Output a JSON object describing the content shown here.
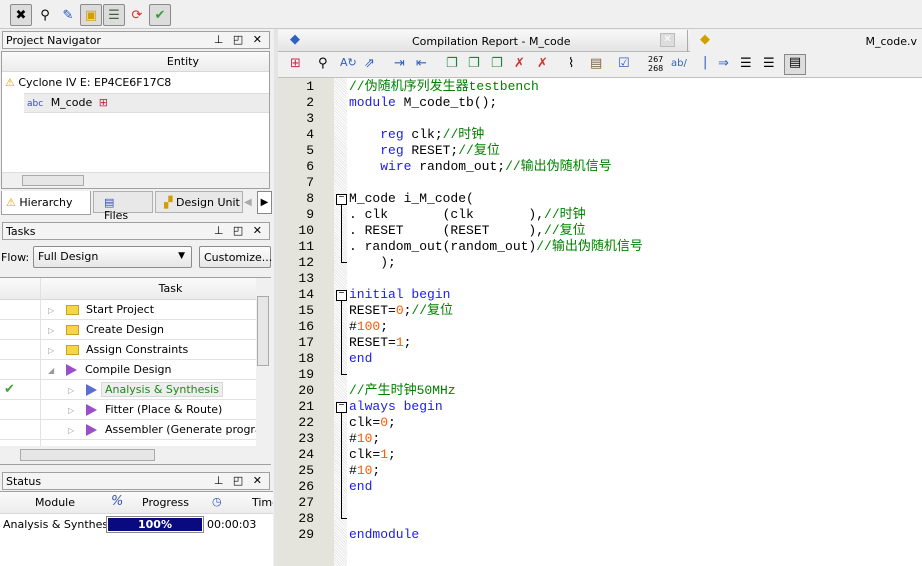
{
  "toolbar": {
    "icons": [
      "compile-stop-icon",
      "rtl-viewer-icon",
      "edit-icon",
      "pin-planner-icon",
      "chip-planner-icon",
      "refresh-icon",
      "checklist-icon"
    ]
  },
  "navigator": {
    "title": "Project Navigator",
    "col": "Entity",
    "device": "Cyclone IV E: EP4CE6F17C8",
    "entity": "M_code",
    "tabs": [
      {
        "label": "Hierarchy"
      },
      {
        "label": "Files"
      },
      {
        "label": "Design Unit"
      }
    ]
  },
  "tasks": {
    "title": "Tasks",
    "flow_label": "Flow:",
    "flow_value": "Full Design",
    "customize": "Customize...",
    "col": "Task",
    "rows": [
      {
        "label": "Start Project",
        "icon": "folder",
        "indent": 0,
        "status": ""
      },
      {
        "label": "Create Design",
        "icon": "folder",
        "indent": 0,
        "status": ""
      },
      {
        "label": "Assign Constraints",
        "icon": "folder",
        "indent": 0,
        "status": ""
      },
      {
        "label": "Compile Design",
        "icon": "play",
        "indent": 0,
        "status": "",
        "expanded": true
      },
      {
        "label": "Analysis & Synthesis",
        "icon": "play-blue",
        "indent": 1,
        "status": "done",
        "selected": true
      },
      {
        "label": "Fitter (Place & Route)",
        "icon": "play",
        "indent": 1,
        "status": ""
      },
      {
        "label": "Assembler (Generate programming files)",
        "icon": "play",
        "indent": 1,
        "status": ""
      }
    ]
  },
  "status": {
    "title": "Status",
    "cols": [
      "Module",
      "%",
      "Progress",
      "Time"
    ],
    "module": "Analysis & Synthesis",
    "progress_pct": 100,
    "progress_label": "100%",
    "time": "00:00:03"
  },
  "editor": {
    "tab_report": "Compilation Report - M_code",
    "tab_file": "M_code.v",
    "toolbar_lines": "267\n268",
    "toolbar_ab": "ab/",
    "lines": [
      [
        [
          "//伪随机序列发生器testbench",
          "cm"
        ]
      ],
      [
        [
          "module",
          "kw"
        ],
        [
          " M_code_tb();",
          "tx"
        ]
      ],
      [],
      [
        [
          "    ",
          "tx"
        ],
        [
          "reg",
          "kw"
        ],
        [
          " clk;",
          "tx"
        ],
        [
          "//时钟",
          "cm"
        ]
      ],
      [
        [
          "    ",
          "tx"
        ],
        [
          "reg",
          "kw"
        ],
        [
          " RESET;",
          "tx"
        ],
        [
          "//复位",
          "cm"
        ]
      ],
      [
        [
          "    ",
          "tx"
        ],
        [
          "wire",
          "kw"
        ],
        [
          " random_out;",
          "tx"
        ],
        [
          "//输出伪随机信号",
          "cm"
        ]
      ],
      [],
      [
        [
          "M_code i_M_code(",
          "tx"
        ]
      ],
      [
        [
          ". clk       (clk       ),",
          "tx"
        ],
        [
          "//时钟",
          "cm"
        ]
      ],
      [
        [
          ". RESET     (RESET     ),",
          "tx"
        ],
        [
          "//复位",
          "cm"
        ]
      ],
      [
        [
          ". random_out(random_out)",
          "tx"
        ],
        [
          "//输出伪随机信号",
          "cm"
        ]
      ],
      [
        [
          "    );",
          "tx"
        ]
      ],
      [],
      [
        [
          "initial",
          "kw"
        ],
        [
          " ",
          "tx"
        ],
        [
          "begin",
          "kw"
        ]
      ],
      [
        [
          "RESET=",
          "tx"
        ],
        [
          "0",
          "nm"
        ],
        [
          ";",
          "tx"
        ],
        [
          "//复位",
          "cm"
        ]
      ],
      [
        [
          "#",
          "tx"
        ],
        [
          "100",
          "nm"
        ],
        [
          ";",
          "tx"
        ]
      ],
      [
        [
          "RESET=",
          "tx"
        ],
        [
          "1",
          "nm"
        ],
        [
          ";",
          "tx"
        ]
      ],
      [
        [
          "end",
          "kw"
        ]
      ],
      [],
      [
        [
          "//产生时钟50MHz",
          "cm"
        ]
      ],
      [
        [
          "always",
          "kw"
        ],
        [
          " ",
          "tx"
        ],
        [
          "begin",
          "kw"
        ]
      ],
      [
        [
          "clk=",
          "tx"
        ],
        [
          "0",
          "nm"
        ],
        [
          ";",
          "tx"
        ]
      ],
      [
        [
          "#",
          "tx"
        ],
        [
          "10",
          "nm"
        ],
        [
          ";",
          "tx"
        ]
      ],
      [
        [
          "clk=",
          "tx"
        ],
        [
          "1",
          "nm"
        ],
        [
          ";",
          "tx"
        ]
      ],
      [
        [
          "#",
          "tx"
        ],
        [
          "10",
          "nm"
        ],
        [
          ";",
          "tx"
        ]
      ],
      [
        [
          "end",
          "kw"
        ]
      ],
      [],
      [],
      [
        [
          "endmodule",
          "kw"
        ]
      ]
    ]
  }
}
